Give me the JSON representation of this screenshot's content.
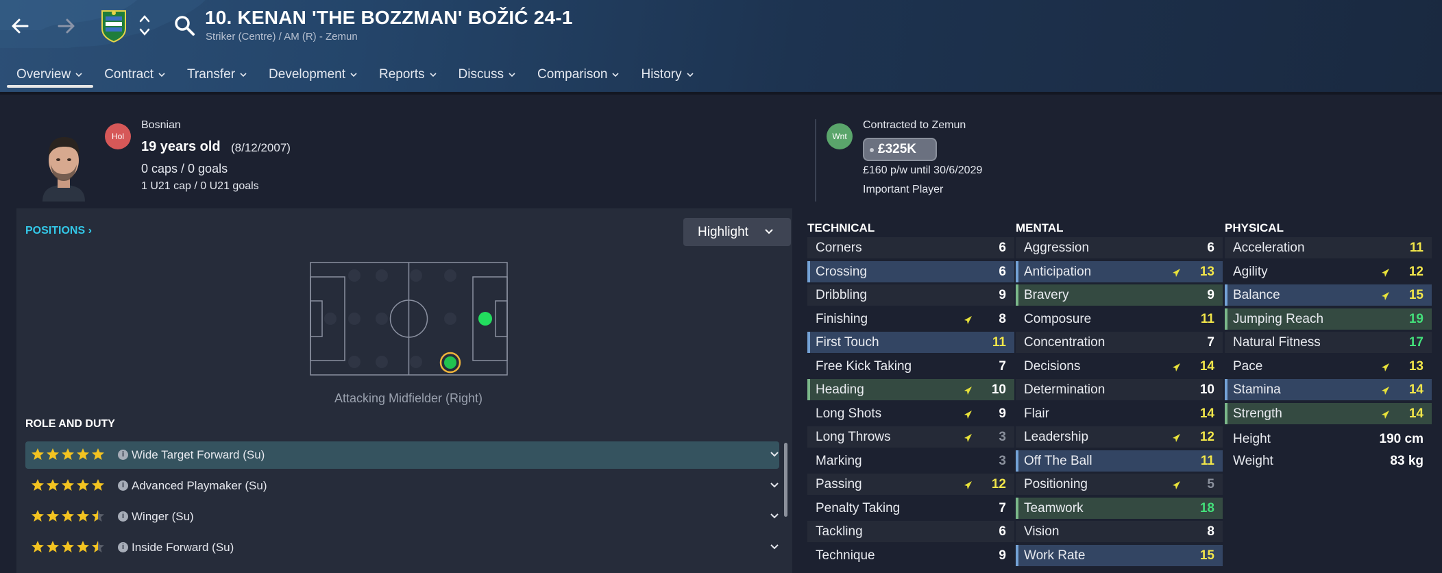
{
  "header": {
    "title": "10. KENAN 'THE BOZZMAN' BOŽIĆ 24-1",
    "subtitle": "Striker (Centre) / AM (R) - Zemun"
  },
  "tabs": [
    {
      "label": "Overview"
    },
    {
      "label": "Contract"
    },
    {
      "label": "Transfer"
    },
    {
      "label": "Development"
    },
    {
      "label": "Reports"
    },
    {
      "label": "Discuss"
    },
    {
      "label": "Comparison"
    },
    {
      "label": "History"
    }
  ],
  "player": {
    "hol_badge": "Hol",
    "nationality": "Bosnian",
    "age": "19 years old",
    "dob": "(8/12/2007)",
    "caps": "0 caps / 0 goals",
    "u21_caps": "1 U21 cap / 0 U21 goals"
  },
  "contract": {
    "wnt_badge": "Wnt",
    "contracted_to": "Contracted to Zemun",
    "value": "£325K",
    "wage": "£160 p/w until 30/6/2029",
    "status": "Important Player"
  },
  "positions": {
    "title": "POSITIONS",
    "highlight_label": "Highlight",
    "caption": "Attacking Midfielder (Right)"
  },
  "roles": {
    "title": "ROLE AND DUTY",
    "items": [
      {
        "name": "Wide Target Forward (Su)",
        "stars": 5
      },
      {
        "name": "Advanced Playmaker (Su)",
        "stars": 5
      },
      {
        "name": "Winger (Su)",
        "stars": 4.5
      },
      {
        "name": "Inside Forward (Su)",
        "stars": 4.5
      }
    ]
  },
  "attributes": {
    "technical": {
      "title": "TECHNICAL",
      "items": [
        {
          "name": "Corners",
          "value": "6"
        },
        {
          "name": "Crossing",
          "value": "6"
        },
        {
          "name": "Dribbling",
          "value": "9"
        },
        {
          "name": "Finishing",
          "value": "8"
        },
        {
          "name": "First Touch",
          "value": "11"
        },
        {
          "name": "Free Kick Taking",
          "value": "7"
        },
        {
          "name": "Heading",
          "value": "10"
        },
        {
          "name": "Long Shots",
          "value": "9"
        },
        {
          "name": "Long Throws",
          "value": "3"
        },
        {
          "name": "Marking",
          "value": "3"
        },
        {
          "name": "Passing",
          "value": "12"
        },
        {
          "name": "Penalty Taking",
          "value": "7"
        },
        {
          "name": "Tackling",
          "value": "6"
        },
        {
          "name": "Technique",
          "value": "9"
        }
      ]
    },
    "mental": {
      "title": "MENTAL",
      "items": [
        {
          "name": "Aggression",
          "value": "6"
        },
        {
          "name": "Anticipation",
          "value": "13"
        },
        {
          "name": "Bravery",
          "value": "9"
        },
        {
          "name": "Composure",
          "value": "11"
        },
        {
          "name": "Concentration",
          "value": "7"
        },
        {
          "name": "Decisions",
          "value": "14"
        },
        {
          "name": "Determination",
          "value": "10"
        },
        {
          "name": "Flair",
          "value": "14"
        },
        {
          "name": "Leadership",
          "value": "12"
        },
        {
          "name": "Off The Ball",
          "value": "11"
        },
        {
          "name": "Positioning",
          "value": "5"
        },
        {
          "name": "Teamwork",
          "value": "18"
        },
        {
          "name": "Vision",
          "value": "8"
        },
        {
          "name": "Work Rate",
          "value": "15"
        }
      ]
    },
    "physical": {
      "title": "PHYSICAL",
      "items": [
        {
          "name": "Acceleration",
          "value": "11"
        },
        {
          "name": "Agility",
          "value": "12"
        },
        {
          "name": "Balance",
          "value": "15"
        },
        {
          "name": "Jumping Reach",
          "value": "19"
        },
        {
          "name": "Natural Fitness",
          "value": "17"
        },
        {
          "name": "Pace",
          "value": "13"
        },
        {
          "name": "Stamina",
          "value": "14"
        },
        {
          "name": "Strength",
          "value": "14"
        }
      ],
      "height_label": "Height",
      "height": "190 cm",
      "weight_label": "Weight",
      "weight": "83 kg"
    }
  },
  "colors": {
    "accent_cyan": "#33c8e8",
    "value_yellow": "#f2e64a",
    "value_green": "#43e07a",
    "value_grey": "#8a909c",
    "arrow_yellow": "#e8e23a"
  }
}
